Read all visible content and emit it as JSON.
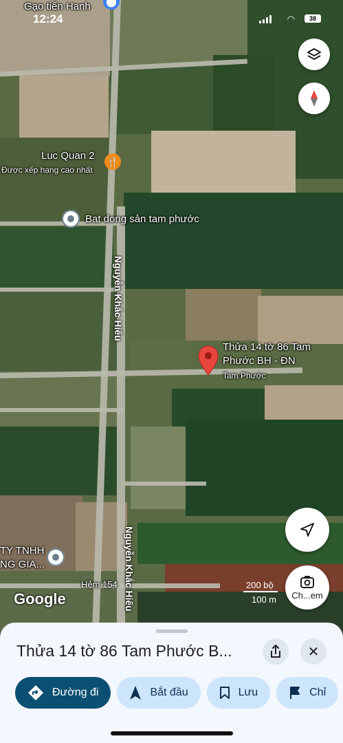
{
  "status_bar": {
    "time": "12:24",
    "battery": "38"
  },
  "map": {
    "labels": {
      "gao": "Gạo tiến Hanh",
      "luc_quan": "Luc Quan 2",
      "luc_quan_sub": "Được xếp hạng cao nhất",
      "bat_dong_san": "Bat dong sản tam phước",
      "road_1": "Nguyễn Khắc Hiếu",
      "road_2": "Nguyễn Khắc Hiếu",
      "pin_title_1": "Thửa 14 tờ 86 Tam",
      "pin_title_2": "Phước BH - ĐN",
      "tam_phuoc": "Tam Phước",
      "company_1": "TY TNHH",
      "company_2": "NG GIA...",
      "hem": "Hẻm 154",
      "google": "Google",
      "scale_ft": "200 bộ",
      "scale_m": "100 m"
    },
    "lens_label": "Ch...em"
  },
  "sheet": {
    "title": "Thửa 14 tờ 86 Tam Phước B...",
    "chips": {
      "directions": "Đường đi",
      "start": "Bắt đầu",
      "save": "Lưu",
      "share_cut": "Chỉ"
    }
  },
  "colors": {
    "primary": "#0b4f72",
    "chip": "#cde5fb",
    "pin_red": "#e8453c"
  }
}
